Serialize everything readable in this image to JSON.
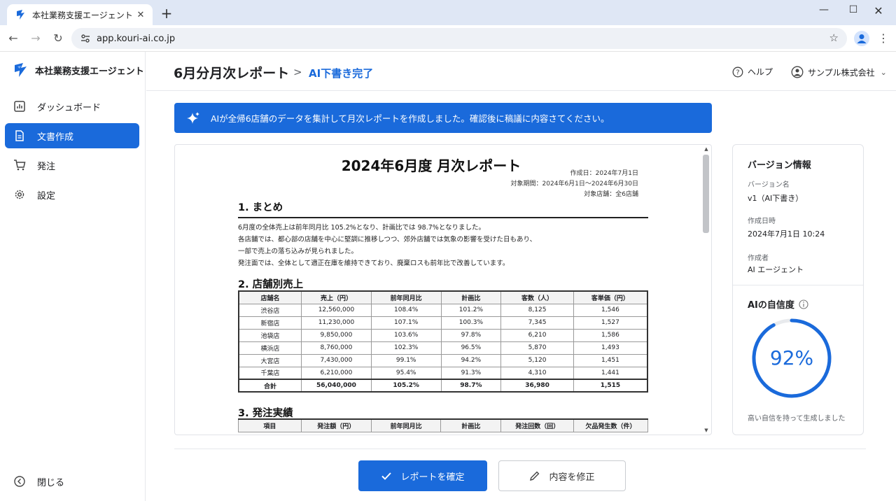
{
  "browser": {
    "tab_title": "本社業務支援エージェント",
    "url": "app.kouri-ai.co.jp"
  },
  "sidebar": {
    "brand": "本社業務支援エージェント",
    "items": [
      {
        "label": "ダッシュボード",
        "icon": "chart-icon",
        "active": false
      },
      {
        "label": "文書作成",
        "icon": "document-icon",
        "active": true
      },
      {
        "label": "発注",
        "icon": "cart-icon",
        "active": false
      },
      {
        "label": "設定",
        "icon": "gear-icon",
        "active": false
      }
    ],
    "close_label": "閉じる"
  },
  "header": {
    "title": "6月分月次レポート",
    "separator": ">",
    "status": "AI下書き完了",
    "help": "ヘルプ",
    "account": "サンプル株式会社"
  },
  "banner": {
    "text": "AIが全帰6店舗のデータを集計して月次レポートを作成しました。確認後に稿議に内容さてください。"
  },
  "report": {
    "title": "2024年6月度 月次レポート",
    "meta": [
      "作成日：2024年7月1日",
      "対象期間：2024年6月1日～2024年6月30日",
      "対象店舗：全6店舗"
    ],
    "section1": {
      "heading": "1. まとめ",
      "paragraphs": [
        "6月度の全体売上は前年同月比 105.2%となり、計画比では 98.7%となりました。",
        "各店舗では、都心部の店舗を中心に堅調に推移しつつ、郊外店舗では気象の影響を受けた日もあり、",
        "一部で売上の落ち込みが見られました。",
        "発注面では、全体として適正在庫を維持できており、廃棄ロスも前年比で改善しています。"
      ]
    },
    "section2": {
      "heading": "2. 店舗別売上",
      "columns": [
        "店舗名",
        "売上（円）",
        "前年同月比",
        "計画比",
        "客数（人）",
        "客単価（円）"
      ],
      "rows": [
        [
          "渋谷店",
          "12,560,000",
          "108.4%",
          "101.2%",
          "8,125",
          "1,546"
        ],
        [
          "新宿店",
          "11,230,000",
          "107.1%",
          "100.3%",
          "7,345",
          "1,527"
        ],
        [
          "池袋店",
          "9,850,000",
          "103.6%",
          "97.8%",
          "6,210",
          "1,586"
        ],
        [
          "横浜店",
          "8,760,000",
          "102.3%",
          "96.5%",
          "5,870",
          "1,493"
        ],
        [
          "大宮店",
          "7,430,000",
          "99.1%",
          "94.2%",
          "5,120",
          "1,451"
        ],
        [
          "千葉店",
          "6,210,000",
          "95.4%",
          "91.3%",
          "4,310",
          "1,441"
        ]
      ],
      "total": [
        "合計",
        "56,040,000",
        "105.2%",
        "98.7%",
        "36,980",
        "1,515"
      ]
    },
    "section3": {
      "heading": "3. 発注実績",
      "columns": [
        "項目",
        "発注額（円）",
        "前年同月比",
        "計画比",
        "発注回数（回）",
        "欠品発生数（件）"
      ]
    }
  },
  "version_panel": {
    "heading": "バージョン情報",
    "version_label": "バージョン名",
    "version_value": "v1（AI下書き）",
    "created_label": "作成日時",
    "created_value": "2024年7月1日 10:24",
    "author_label": "作成者",
    "author_value": "AI エージェント"
  },
  "confidence": {
    "heading": "AIの自信度",
    "value": 92,
    "display": "92%",
    "note": "高い自信を持って生成しました",
    "color": "#1a6adb"
  },
  "actions": {
    "confirm": "レポートを確定",
    "edit": "内容を修正"
  }
}
